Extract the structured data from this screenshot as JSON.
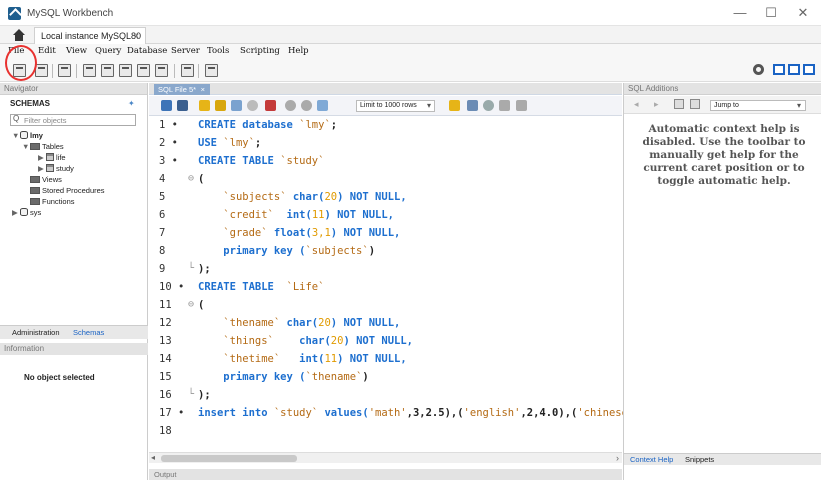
{
  "window": {
    "title": "MySQL Workbench",
    "minimize": "—",
    "maximize": "☐",
    "close": "✕"
  },
  "connection_tab": {
    "label": "Local instance MySQL80",
    "close": "×"
  },
  "menu": [
    "File",
    "Edit",
    "View",
    "Query",
    "Database",
    "Server",
    "Tools",
    "Scripting",
    "Help"
  ],
  "navigator": {
    "header": "Navigator",
    "schemas_label": "SCHEMAS",
    "filter_placeholder": "Filter objects",
    "tree": {
      "db1": "lmy",
      "tables": "Tables",
      "table1": "life",
      "table2": "study",
      "views": "Views",
      "procedures": "Stored Procedures",
      "functions": "Functions",
      "db2": "sys"
    },
    "tab_admin": "Administration",
    "tab_schemas": "Schemas",
    "info_header": "Information",
    "no_object": "No object selected"
  },
  "editor": {
    "tab_label": "SQL File 5*",
    "tab_close": "×",
    "limit_label": "Limit to 1000 rows",
    "lines": [
      {
        "n": "1",
        "dot": "•"
      },
      {
        "n": "2",
        "dot": "•"
      },
      {
        "n": "3",
        "dot": "•"
      },
      {
        "n": "4",
        "dot": ""
      },
      {
        "n": "5",
        "dot": ""
      },
      {
        "n": "6",
        "dot": ""
      },
      {
        "n": "7",
        "dot": ""
      },
      {
        "n": "8",
        "dot": ""
      },
      {
        "n": "9",
        "dot": ""
      },
      {
        "n": "10",
        "dot": "•"
      },
      {
        "n": "11",
        "dot": ""
      },
      {
        "n": "12",
        "dot": ""
      },
      {
        "n": "13",
        "dot": ""
      },
      {
        "n": "14",
        "dot": ""
      },
      {
        "n": "15",
        "dot": ""
      },
      {
        "n": "16",
        "dot": ""
      },
      {
        "n": "17",
        "dot": "•"
      },
      {
        "n": "18",
        "dot": ""
      }
    ],
    "code": {
      "l1a": "CREATE database ",
      "l1b": "`lmy`",
      "l1c": ";",
      "l2a": "USE ",
      "l2b": "`lmy`",
      "l2c": ";",
      "l3a": "CREATE TABLE ",
      "l3b": "`study`",
      "l4": "(",
      "l5a": "    ",
      "l5b": "`subjects`",
      "l5c": " char(",
      "l5d": "20",
      "l5e": ") NOT NULL,",
      "l6a": "    ",
      "l6b": "`credit`",
      "l6c": "  int(",
      "l6d": "11",
      "l6e": ") NOT NULL,",
      "l7a": "    ",
      "l7b": "`grade`",
      "l7c": " float(",
      "l7d": "3,1",
      "l7e": ") NOT NULL,",
      "l8a": "    primary key (",
      "l8b": "`subjects`",
      "l8c": ")",
      "l9": ");",
      "l10a": "CREATE TABLE  ",
      "l10b": "`Life`",
      "l11": "(",
      "l12a": "    ",
      "l12b": "`thename`",
      "l12c": " char(",
      "l12d": "20",
      "l12e": ") NOT NULL,",
      "l13a": "    ",
      "l13b": "`things`",
      "l13c": "    char(",
      "l13d": "20",
      "l13e": ") NOT NULL,",
      "l14a": "    ",
      "l14b": "`thetime`",
      "l14c": "   int(",
      "l14d": "11",
      "l14e": ") NOT NULL,",
      "l15a": "    primary key (",
      "l15b": "`thename`",
      "l15c": ")",
      "l16": ");",
      "l17a": "insert into ",
      "l17b": "`study`",
      "l17c": " values(",
      "l17d": "'math'",
      "l17e": ",3,2.5),(",
      "l17f": "'english'",
      "l17g": ",2,4.0),(",
      "l17h": "'chinese"
    },
    "scroll_left": "◂",
    "scroll_right": "›",
    "output_label": "Output"
  },
  "sql_additions": {
    "header": "SQL Additions",
    "jump_label": "Jump to",
    "help_text": "Automatic context help is disabled. Use the toolbar to manually get help for the current caret position or to toggle automatic help.",
    "tab_context": "Context Help",
    "tab_snippets": "Snippets"
  }
}
